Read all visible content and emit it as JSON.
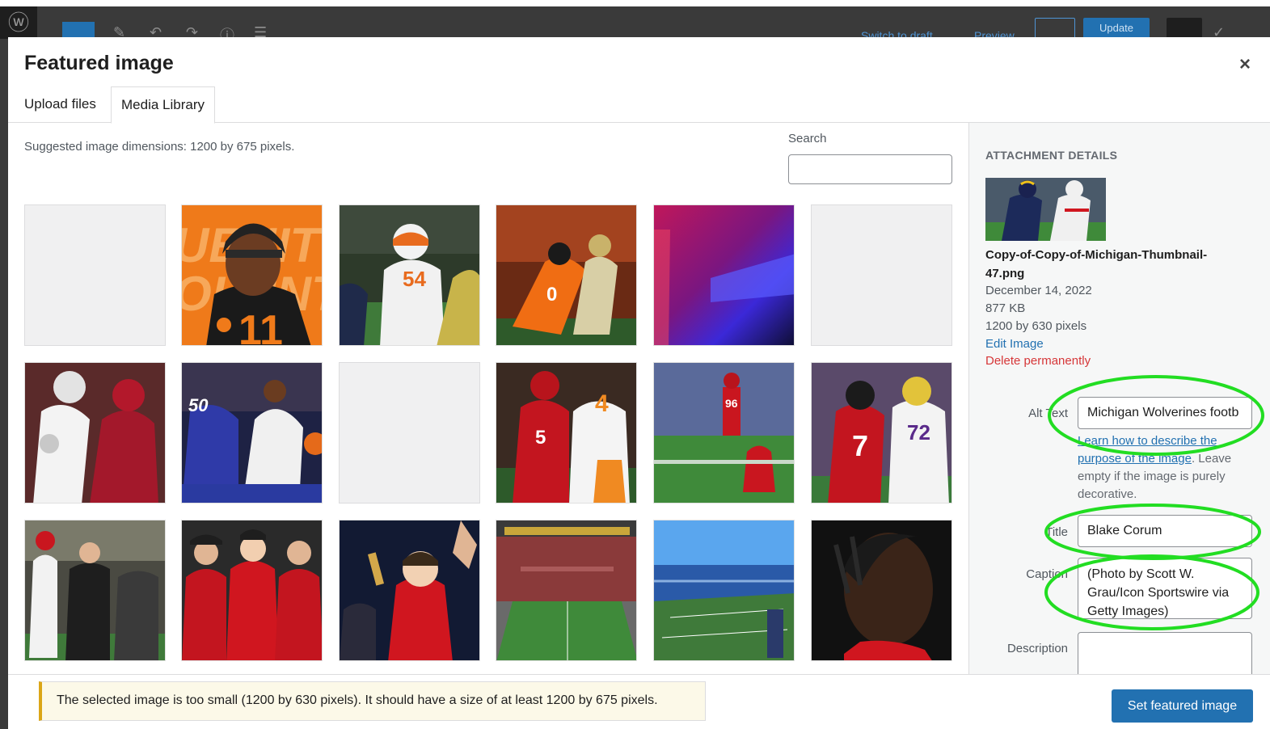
{
  "topbar": {
    "switch_to_draft": "Switch to draft",
    "preview": "Preview",
    "update": "Update"
  },
  "modal": {
    "title": "Featured image",
    "close_glyph": "×",
    "tabs": [
      {
        "label": "Upload files"
      },
      {
        "label": "Media Library"
      }
    ],
    "suggested_text": "Suggested image dimensions: 1200 by 675 pixels.",
    "search_label": "Search",
    "search_value": ""
  },
  "grid": {
    "tiles": [
      {
        "kind": "blank",
        "icon": "blank-thumbnail"
      },
      {
        "kind": "photo",
        "icon": "football-player-orange-jersey"
      },
      {
        "kind": "photo",
        "icon": "football-linemen"
      },
      {
        "kind": "photo",
        "icon": "football-tackle-orange"
      },
      {
        "kind": "photo",
        "icon": "pink-blue-blur"
      },
      {
        "kind": "blank",
        "icon": "blank-thumbnail"
      },
      {
        "kind": "photo",
        "icon": "football-red-white-players"
      },
      {
        "kind": "photo",
        "icon": "basketball-players"
      },
      {
        "kind": "blank",
        "icon": "blank-thumbnail"
      },
      {
        "kind": "photo",
        "icon": "football-red-and-orange"
      },
      {
        "kind": "photo",
        "icon": "football-kicker-field"
      },
      {
        "kind": "photo",
        "icon": "football-runner-red-7"
      },
      {
        "kind": "photo",
        "icon": "coach-sideline"
      },
      {
        "kind": "photo",
        "icon": "team-celebration"
      },
      {
        "kind": "photo",
        "icon": "fans-celebrating"
      },
      {
        "kind": "photo",
        "icon": "stadium-interior"
      },
      {
        "kind": "photo",
        "icon": "stadium-aerial-blue-seats"
      },
      {
        "kind": "photo",
        "icon": "player-portrait-dark"
      }
    ]
  },
  "sidebar": {
    "heading": "ATTACHMENT DETAILS",
    "filename": "Copy-of-Copy-of-Michigan-Thumbnail-47.png",
    "date": "December 14, 2022",
    "size": "877 KB",
    "dimensions": "1200 by 630 pixels",
    "edit_link": "Edit Image",
    "delete_link": "Delete permanently",
    "alt_label": "Alt Text",
    "alt_value": "Michigan Wolverines footb",
    "help_link": "Learn how to describe the purpose of the image",
    "help_rest": ". Leave empty if the image is purely decorative.",
    "title_label": "Title",
    "title_value": "Blake Corum",
    "caption_label": "Caption",
    "caption_value": "(Photo by Scott W. Grau/Icon Sportswire via Getty Images)",
    "description_label": "Description",
    "description_value": ""
  },
  "footer": {
    "notice": "The selected image is too small (1200 by 630 pixels). It should have a size of at least 1200 by 675 pixels.",
    "set_button": "Set featured image"
  },
  "colors": {
    "primary": "#2271b1",
    "danger": "#d63638",
    "warning_border": "#dba617",
    "highlight_ellipse": "#22dd22"
  }
}
